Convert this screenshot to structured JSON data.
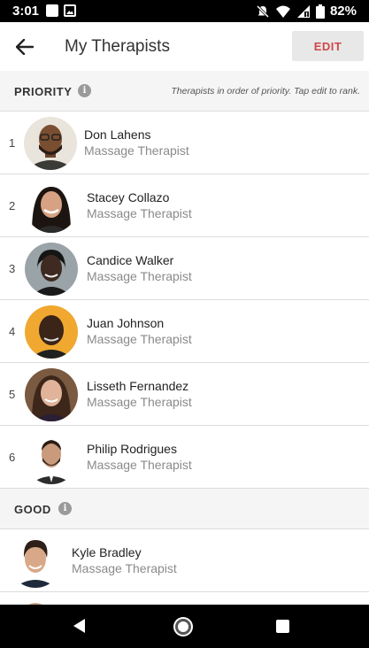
{
  "status_bar": {
    "time": "3:01",
    "battery": "82%"
  },
  "app_bar": {
    "title": "My Therapists",
    "edit_label": "EDIT"
  },
  "priority": {
    "label": "PRIORITY",
    "note": "Therapists in order of priority. Tap edit to rank.",
    "therapists": [
      {
        "rank": "1",
        "name": "Don Lahens",
        "role": "Massage Therapist"
      },
      {
        "rank": "2",
        "name": "Stacey Collazo",
        "role": "Massage Therapist"
      },
      {
        "rank": "3",
        "name": "Candice Walker",
        "role": "Massage Therapist"
      },
      {
        "rank": "4",
        "name": "Juan Johnson",
        "role": "Massage Therapist"
      },
      {
        "rank": "5",
        "name": "Lisseth Fernandez",
        "role": "Massage Therapist"
      },
      {
        "rank": "6",
        "name": "Philip Rodrigues",
        "role": "Massage Therapist"
      }
    ]
  },
  "good": {
    "label": "GOOD",
    "therapists": [
      {
        "name": "Kyle Bradley",
        "role": "Massage Therapist"
      }
    ]
  }
}
